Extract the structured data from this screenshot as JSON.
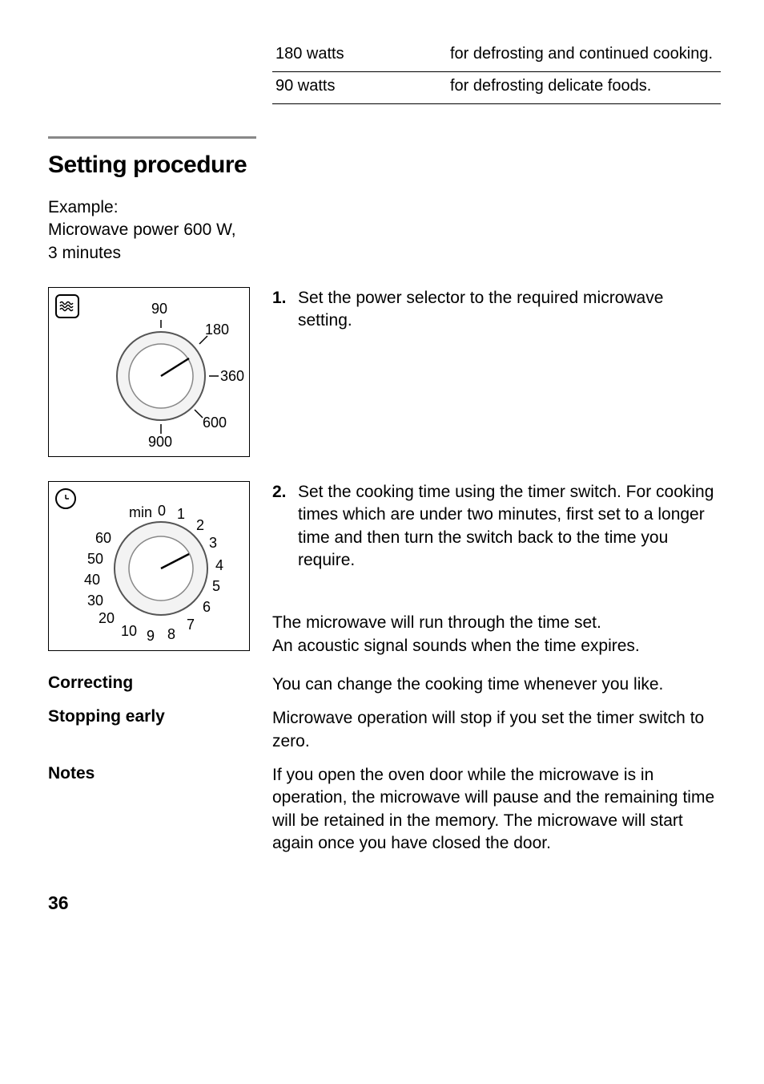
{
  "watt_rows": [
    {
      "w": "180 watts",
      "desc": "for defrosting and continued cooking."
    },
    {
      "w": "90 watts",
      "desc": "for defrosting delicate foods."
    }
  ],
  "section_title": "Setting procedure",
  "example": {
    "l1": "Example:",
    "l2": "Microwave power 600 W,",
    "l3": "3 minutes"
  },
  "step1": {
    "n": "1.",
    "txt": "Set the power selector to the required microwave setting."
  },
  "step2": {
    "n": "2.",
    "txt": "Set the cooking time using the timer switch. For cooking times which are under two minutes, first set to a longer time and then turn the switch back to the time you require."
  },
  "after_step2_a": "The microwave will run through the time set.",
  "after_step2_b": "An acoustic signal sounds when the time expires.",
  "correcting": {
    "k": "Correcting",
    "v": "You can change the cooking time whenever you like."
  },
  "stopping": {
    "k": "Stopping early",
    "v": "Microwave operation will stop if you set the timer switch to zero."
  },
  "notes": {
    "k": "Notes",
    "v": "If you open the oven door while the microwave is in operation, the microwave will pause and the remaining time will be retained in the memory. The microwave will start again once you have closed the door."
  },
  "page_number": "36",
  "power_dial": {
    "labels": [
      "90",
      "180",
      "360",
      "600",
      "900"
    ]
  },
  "timer_dial": {
    "unit": "min",
    "labels": [
      "0",
      "1",
      "2",
      "3",
      "4",
      "5",
      "6",
      "7",
      "8",
      "9",
      "10",
      "20",
      "30",
      "40",
      "50",
      "60"
    ]
  }
}
